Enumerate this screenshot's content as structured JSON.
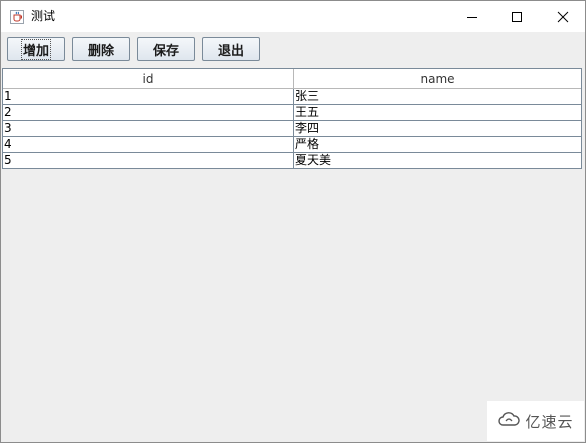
{
  "window": {
    "title": "测试",
    "icon": "java-cup-icon",
    "controls": [
      "minimize-icon",
      "maximize-icon",
      "close-icon"
    ]
  },
  "toolbar": {
    "add_label": "增加",
    "delete_label": "删除",
    "save_label": "保存",
    "exit_label": "退出"
  },
  "table": {
    "columns": [
      "id",
      "name"
    ],
    "rows": [
      {
        "id": "1",
        "name": "张三"
      },
      {
        "id": "2",
        "name": "王五"
      },
      {
        "id": "3",
        "name": "李四"
      },
      {
        "id": "4",
        "name": "严格"
      },
      {
        "id": "5",
        "name": "夏天美"
      }
    ]
  },
  "watermark": {
    "text": "亿速云",
    "icon": "cloud-logo-icon"
  },
  "colors": {
    "border": "#7a8a99",
    "background": "#eeeeee"
  }
}
